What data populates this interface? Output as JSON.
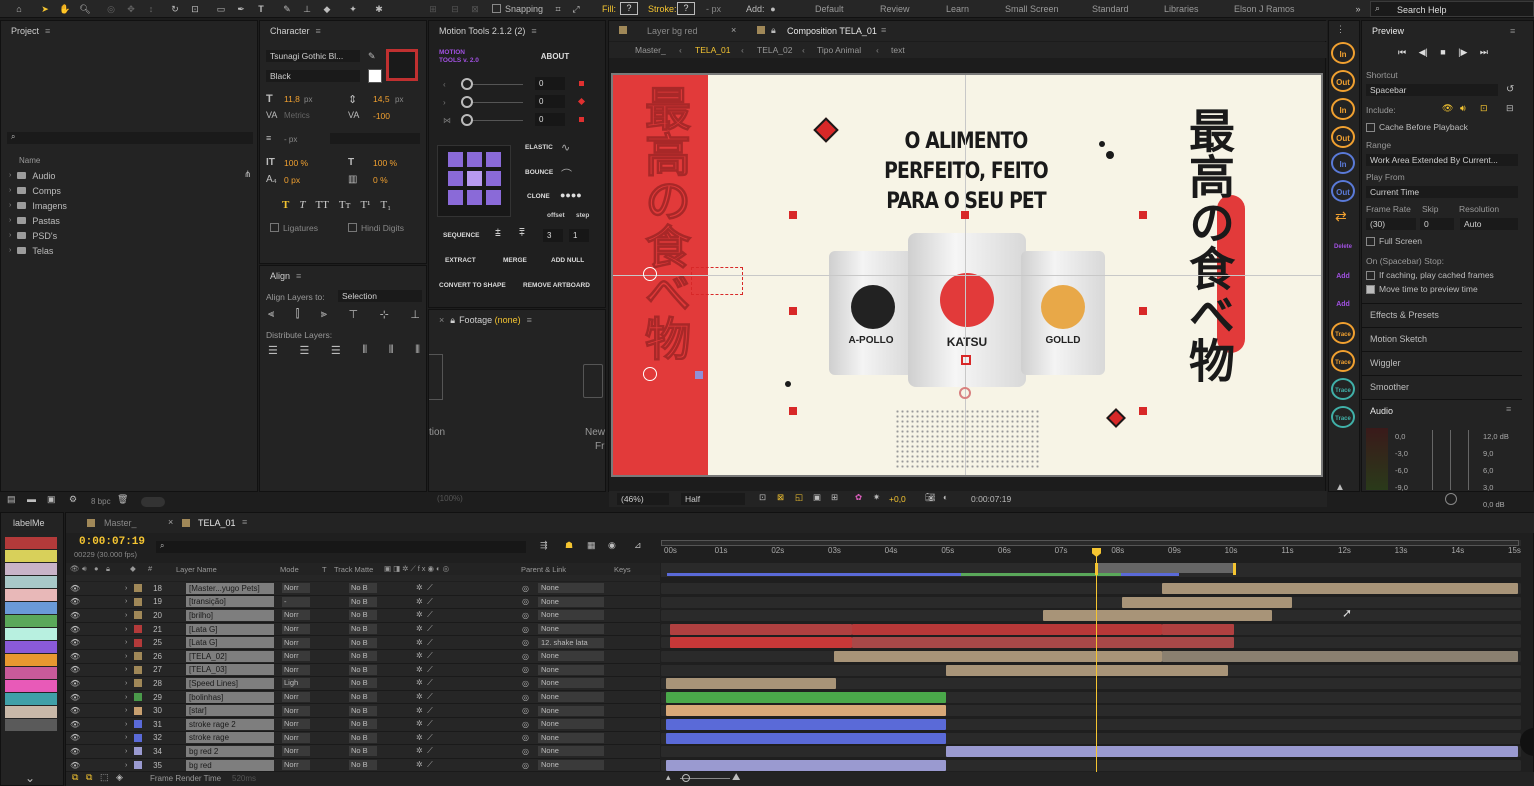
{
  "toolbar": {
    "snapping": "Snapping",
    "fill": "Fill:",
    "fill_val": "?",
    "stroke": "Stroke:",
    "stroke_val": "?",
    "px": "- px",
    "add": "Add:",
    "workspaces": [
      "Default",
      "Review",
      "Learn",
      "Small Screen",
      "Standard",
      "Libraries",
      "Elson J Ramos"
    ],
    "search": "Search Help"
  },
  "project": {
    "title": "Project",
    "name_col": "Name",
    "items": [
      "Audio",
      "Comps",
      "Imagens",
      "Pastas",
      "PSD's",
      "Telas"
    ],
    "bpc": "8 bpc"
  },
  "character": {
    "title": "Character",
    "font": "Tsunagi Gothic Bl...",
    "style": "Black",
    "size": "11,8",
    "size_unit": "px",
    "leading": "14,5",
    "leading_unit": "px",
    "kerning": "Metrics",
    "tracking": "-100",
    "stroke_px": "- px",
    "vscale": "100 %",
    "hscale": "100 %",
    "baseline": "0 px",
    "tsume": "0 %",
    "ligatures": "Ligatures",
    "hindi": "Hindi Digits",
    "styles": [
      "T",
      "T",
      "TT",
      "Tт",
      "T¹",
      "T₁"
    ]
  },
  "align": {
    "title": "Align",
    "align_to_label": "Align Layers to:",
    "align_to": "Selection",
    "distribute": "Distribute Layers:"
  },
  "motion_tools": {
    "title": "Motion Tools 2.1.2 (2)",
    "logo": "MOTION TOOLS v. 2.0",
    "about": "ABOUT",
    "values": [
      "0",
      "0",
      "0"
    ],
    "elastic": "ELASTIC",
    "bounce": "BOUNCE",
    "clone": "CLONE",
    "offset": "offset",
    "step": "step",
    "sequence": "SEQUENCE",
    "seq_vals": [
      "3",
      "1"
    ],
    "extract": "EXTRACT",
    "merge": "MERGE",
    "add_null": "ADD NULL",
    "convert": "CONVERT TO SHAPE",
    "remove": "REMOVE ARTBOARD"
  },
  "footage": {
    "title": "Footage",
    "value": "(none)",
    "left_text": "tion",
    "right_text": "New",
    "right_text2": "Fr",
    "zoom": "(100%)"
  },
  "viewer": {
    "layer_tab": "Layer bg red",
    "comp_tab": "Composition TELA_01",
    "breadcrumbs": [
      "Master_",
      "TELA_01",
      "TELA_02",
      "Tipo Animal",
      "text"
    ],
    "zoom": "(46%)",
    "resolution": "Half",
    "exposure": "+0,0",
    "time": "0:00:07:19"
  },
  "artwork": {
    "headline": [
      "O ALIMENTO",
      "PERFEITO, FEITO",
      "PARA O SEU PET"
    ],
    "vertical_jp": "最高の食べ物",
    "cans": [
      "A-POLLO",
      "KATSU",
      "GOLLD"
    ]
  },
  "tools_strip": [
    "In",
    "Out",
    "In",
    "Out",
    "In",
    "Out",
    "Delete",
    "Add",
    "Add",
    "Trace",
    "Trace",
    "Trace",
    "Trace"
  ],
  "preview": {
    "title": "Preview",
    "shortcut_label": "Shortcut",
    "shortcut": "Spacebar",
    "include": "Include:",
    "cache": "Cache Before Playback",
    "range_label": "Range",
    "range": "Work Area Extended By Current...",
    "play_from_label": "Play From",
    "play_from": "Current Time",
    "fr_label": "Frame Rate",
    "skip_label": "Skip",
    "res_label": "Resolution",
    "fr": "(30)",
    "skip": "0",
    "res": "Auto",
    "full_screen": "Full Screen",
    "stop_label": "On (Spacebar) Stop:",
    "stop1": "If caching, play cached frames",
    "stop2": "Move time to preview time"
  },
  "panels": [
    "Effects & Presets",
    "Motion Sketch",
    "Wiggler",
    "Smoother"
  ],
  "audio": {
    "title": "Audio",
    "left_scale": [
      "0,0",
      "-3,0",
      "-6,0",
      "-9,0",
      "-12,0"
    ],
    "right_scale": [
      "12,0 dB",
      "9,0",
      "6,0",
      "3,0",
      "0,0 dB"
    ]
  },
  "label_panel": {
    "title": "labelMe",
    "colors": [
      "#b33a3a",
      "#d8d05a",
      "#c8b3c8",
      "#a8c8c8",
      "#e8b8b8",
      "#6a9ad8",
      "#5aa85a",
      "#b8f0e0",
      "#8a5ad8",
      "#e89830",
      "#c85a9a",
      "#e85ab8",
      "#40a0a8",
      "#c8b8a8",
      "#5a5a5a"
    ]
  },
  "timeline": {
    "tabs": [
      "Master_",
      "TELA_01"
    ],
    "timecode": "0:00:07:19",
    "frames": "00229 (30.000 fps)",
    "cols": {
      "name": "Layer Name",
      "mode": "Mode",
      "t": "T",
      "track": "Track Matte",
      "parent": "Parent & Link",
      "keys": "Keys"
    },
    "ticks": [
      "00s",
      "01s",
      "02s",
      "03s",
      "04s",
      "05s",
      "06s",
      "07s",
      "08s",
      "09s",
      "10s",
      "11s",
      "12s",
      "13s",
      "14s",
      "15s"
    ],
    "frame_render": "Frame Render Time",
    "frame_ms": "520ms",
    "layers": [
      {
        "num": "18",
        "name": "[Master...yugo Pets]",
        "mode": "Norr",
        "track": "No B",
        "parent": "None",
        "label": "#a08858"
      },
      {
        "num": "19",
        "name": "[transição]",
        "mode": "-",
        "track": "No B",
        "parent": "None",
        "label": "#a08858"
      },
      {
        "num": "20",
        "name": "[brilho]",
        "mode": "Norr",
        "track": "No B",
        "parent": "None",
        "label": "#a08858"
      },
      {
        "num": "21",
        "name": "[Lata G]",
        "mode": "Norr",
        "track": "No B",
        "parent": "None",
        "label": "#b33a3a"
      },
      {
        "num": "25",
        "name": "[Lata G]",
        "mode": "Norr",
        "track": "No B",
        "parent": "12. shake lata",
        "label": "#b33a3a"
      },
      {
        "num": "26",
        "name": "[TELA_02]",
        "mode": "Norr",
        "track": "No B",
        "parent": "None",
        "label": "#a08858"
      },
      {
        "num": "27",
        "name": "[TELA_03]",
        "mode": "Norr",
        "track": "No B",
        "parent": "None",
        "label": "#a08858"
      },
      {
        "num": "28",
        "name": "[Speed Lines]",
        "mode": "Ligh",
        "track": "No B",
        "parent": "None",
        "label": "#a08858"
      },
      {
        "num": "29",
        "name": "[bolinhas]",
        "mode": "Norr",
        "track": "No B",
        "parent": "None",
        "label": "#4a9a4a"
      },
      {
        "num": "30",
        "name": "[star]",
        "mode": "Norr",
        "track": "No B",
        "parent": "None",
        "label": "#c8a070"
      },
      {
        "num": "31",
        "name": "stroke rage 2",
        "mode": "Norr",
        "track": "No B",
        "parent": "None",
        "label": "#5a6ad8"
      },
      {
        "num": "32",
        "name": "stroke rage",
        "mode": "Norr",
        "track": "No B",
        "parent": "None",
        "label": "#5a6ad8"
      },
      {
        "num": "34",
        "name": "bg red 2",
        "mode": "Norr",
        "track": "No B",
        "parent": "None",
        "label": "#9a9ad0"
      },
      {
        "num": "35",
        "name": "bg red",
        "mode": "Norr",
        "track": "No B",
        "parent": "None",
        "label": "#9a9ad0"
      }
    ]
  }
}
